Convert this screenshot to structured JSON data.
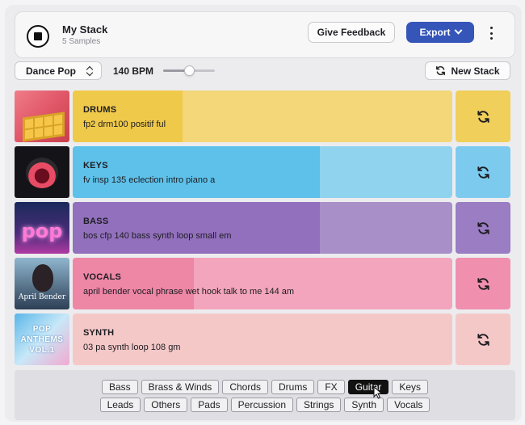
{
  "header": {
    "title": "My Stack",
    "subtitle": "5 Samples",
    "feedback_label": "Give Feedback",
    "export_label": "Export"
  },
  "controls": {
    "genre": "Dance Pop",
    "bpm": "140 BPM",
    "tempo_slider_level": 0.5,
    "new_stack_label": "New Stack"
  },
  "tracks": [
    {
      "name": "DRUMS",
      "file": "fp2 drm100 positif ful",
      "color": "#f3d778",
      "progress_color": "#efc94a",
      "reload_color": "#f0cf5a",
      "playback_progress": 0.29
    },
    {
      "name": "KEYS",
      "file": "fv insp 135 eclection intro piano a",
      "color": "#8fd3ef",
      "progress_color": "#5ec1ea",
      "reload_color": "#7ccbee",
      "playback_progress": 0.65
    },
    {
      "name": "BASS",
      "file": "bos cfp 140 bass synth loop small em",
      "color": "#a98fc8",
      "progress_color": "#9270bd",
      "reload_color": "#9a7dc3",
      "playback_progress": 0.65
    },
    {
      "name": "VOCALS",
      "file": "april bender vocal phrase wet hook talk to me 144 am",
      "color": "#f3a5bd",
      "progress_color": "#ee86a6",
      "reload_color": "#f08fae",
      "playback_progress": 0.32
    },
    {
      "name": "SYNTH",
      "file": "03 pa synth loop 108 gm",
      "color": "#f5c8c8",
      "progress_color": "#f5c8c8",
      "reload_color": "#f5c8c8",
      "playback_progress": 0.0
    }
  ],
  "covers": {
    "bass_text": "pop",
    "vocals_text": "April Bender",
    "synth_line1": "POP",
    "synth_line2": "ANTHEMS",
    "synth_line3": "VOL.1"
  },
  "tags": {
    "row1": [
      "Bass",
      "Brass & Winds",
      "Chords",
      "Drums",
      "FX",
      "Guitar",
      "Keys"
    ],
    "row2": [
      "Leads",
      "Others",
      "Pads",
      "Percussion",
      "Strings",
      "Synth",
      "Vocals"
    ],
    "active": "Guitar"
  },
  "colors": {
    "accent": "#3555b8"
  }
}
